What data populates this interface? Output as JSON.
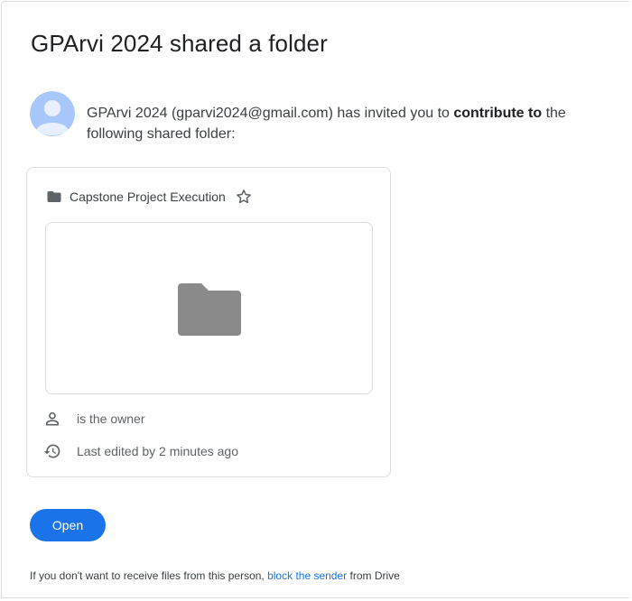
{
  "email": {
    "title": "GPArvi 2024 shared a folder",
    "invite": {
      "prefix": "GPArvi 2024 (gparvi2024@gmail.com) has invited you to ",
      "emphasis": "contribute to",
      "suffix": " the following shared folder:"
    },
    "card": {
      "folder_name": "Capstone Project Execution",
      "owner_text": "is the owner",
      "edited_text": "Last edited by 2 minutes ago"
    },
    "open_button": "Open",
    "footer": {
      "prefix": "If you don't want to receive files from this person, ",
      "link": "block the sender",
      "suffix": " from Drive"
    }
  },
  "colors": {
    "accent": "#1a73e8",
    "folder_gray": "#8a8a8a",
    "avatar_bg": "#a8c7fa",
    "border": "#dadce0"
  },
  "icons": {
    "folder": "folder-icon",
    "star": "star-outline-icon",
    "person": "person-icon",
    "history": "history-icon",
    "avatar": "default-avatar"
  }
}
